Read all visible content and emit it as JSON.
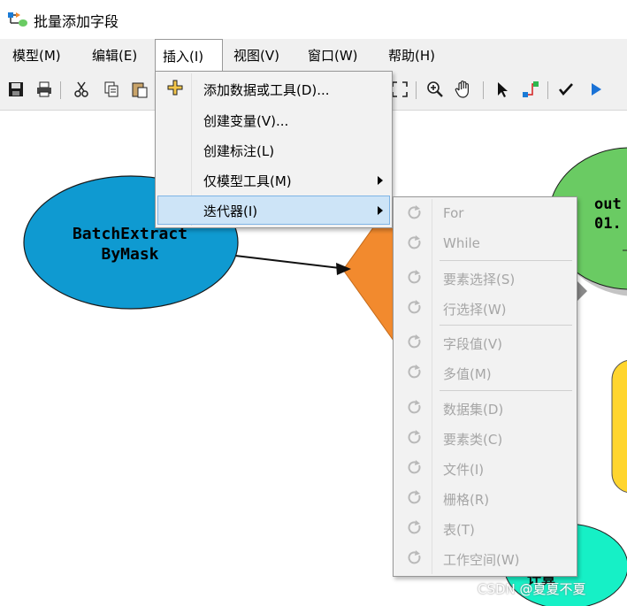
{
  "window": {
    "title": "批量添加字段"
  },
  "menubar": {
    "items": [
      {
        "label": "模型(M)"
      },
      {
        "label": "编辑(E)"
      },
      {
        "label": "插入(I)"
      },
      {
        "label": "视图(V)"
      },
      {
        "label": "窗口(W)"
      },
      {
        "label": "帮助(H)"
      }
    ]
  },
  "insert_menu": {
    "items": [
      {
        "label": "添加数据或工具(D)..."
      },
      {
        "label": "创建变量(V)..."
      },
      {
        "label": "创建标注(L)"
      },
      {
        "label": "仅模型工具(M)"
      },
      {
        "label": "迭代器(I)"
      }
    ]
  },
  "iterator_menu": {
    "items": [
      {
        "label": "For"
      },
      {
        "label": "While"
      },
      {
        "label": "要素选择(S)"
      },
      {
        "label": "行选择(W)"
      },
      {
        "label": "字段值(V)"
      },
      {
        "label": "多值(M)"
      },
      {
        "label": "数据集(D)"
      },
      {
        "label": "要素类(C)"
      },
      {
        "label": "文件(I)"
      },
      {
        "label": "栅格(R)"
      },
      {
        "label": "表(T)"
      },
      {
        "label": "工作空间(W)"
      }
    ]
  },
  "canvas": {
    "tool_node": {
      "line1": "BatchExtract",
      "line2": "ByMask"
    },
    "output_node": {
      "line1": "out",
      "line2": "01."
    },
    "partial_node_text": "计算"
  },
  "colors": {
    "tool_node": "#0f9ad1",
    "process_diamond": "#f28a2e",
    "output_node": "#6acb63",
    "yellow_node": "#ffd52e",
    "cyan_node": "#16f0c6",
    "highlight": "#cde4f7"
  },
  "watermark": "CSDN @夏夏不夏"
}
